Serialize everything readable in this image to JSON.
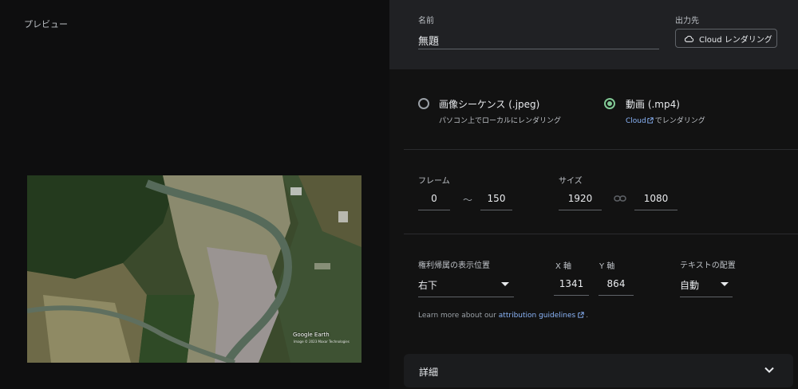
{
  "preview": {
    "label": "プレビュー",
    "map_credit": "Google Earth",
    "map_credit_sub": "Image © 2023 Maxar Technologies"
  },
  "header": {
    "name_label": "名前",
    "name_value": "無題",
    "output_label": "出力先",
    "output_button": "Cloud レンダリング",
    "output_icon": "cloud-icon"
  },
  "format": {
    "jpeg": {
      "title": "画像シーケンス (.jpeg)",
      "subtitle": "パソコン上でローカルにレンダリング",
      "selected": false
    },
    "mp4": {
      "title": "動画 (.mp4)",
      "link": "Cloud",
      "subtitle_rest": "でレンダリング",
      "selected": true
    }
  },
  "frames": {
    "label": "フレーム",
    "start": "0",
    "separator": "〜",
    "end": "150"
  },
  "size": {
    "label": "サイズ",
    "width": "1920",
    "height": "1080",
    "link_icon": "link-icon"
  },
  "attribution": {
    "position_label": "権利帰属の表示位置",
    "position_value": "右下",
    "x_label": "X 軸",
    "x_value": "1341",
    "y_label": "Y 軸",
    "y_value": "864",
    "align_label": "テキストの配置",
    "align_value": "自動",
    "note_prefix": "Learn more about our ",
    "note_link": "attribution guidelines",
    "note_suffix": "."
  },
  "details": {
    "label": "詳細",
    "icon": "chevron-down-icon"
  },
  "colors": {
    "accent_green": "#81c995",
    "link_blue": "#8ab4f8",
    "panel_bg": "#121212",
    "header_bg": "#202124"
  }
}
